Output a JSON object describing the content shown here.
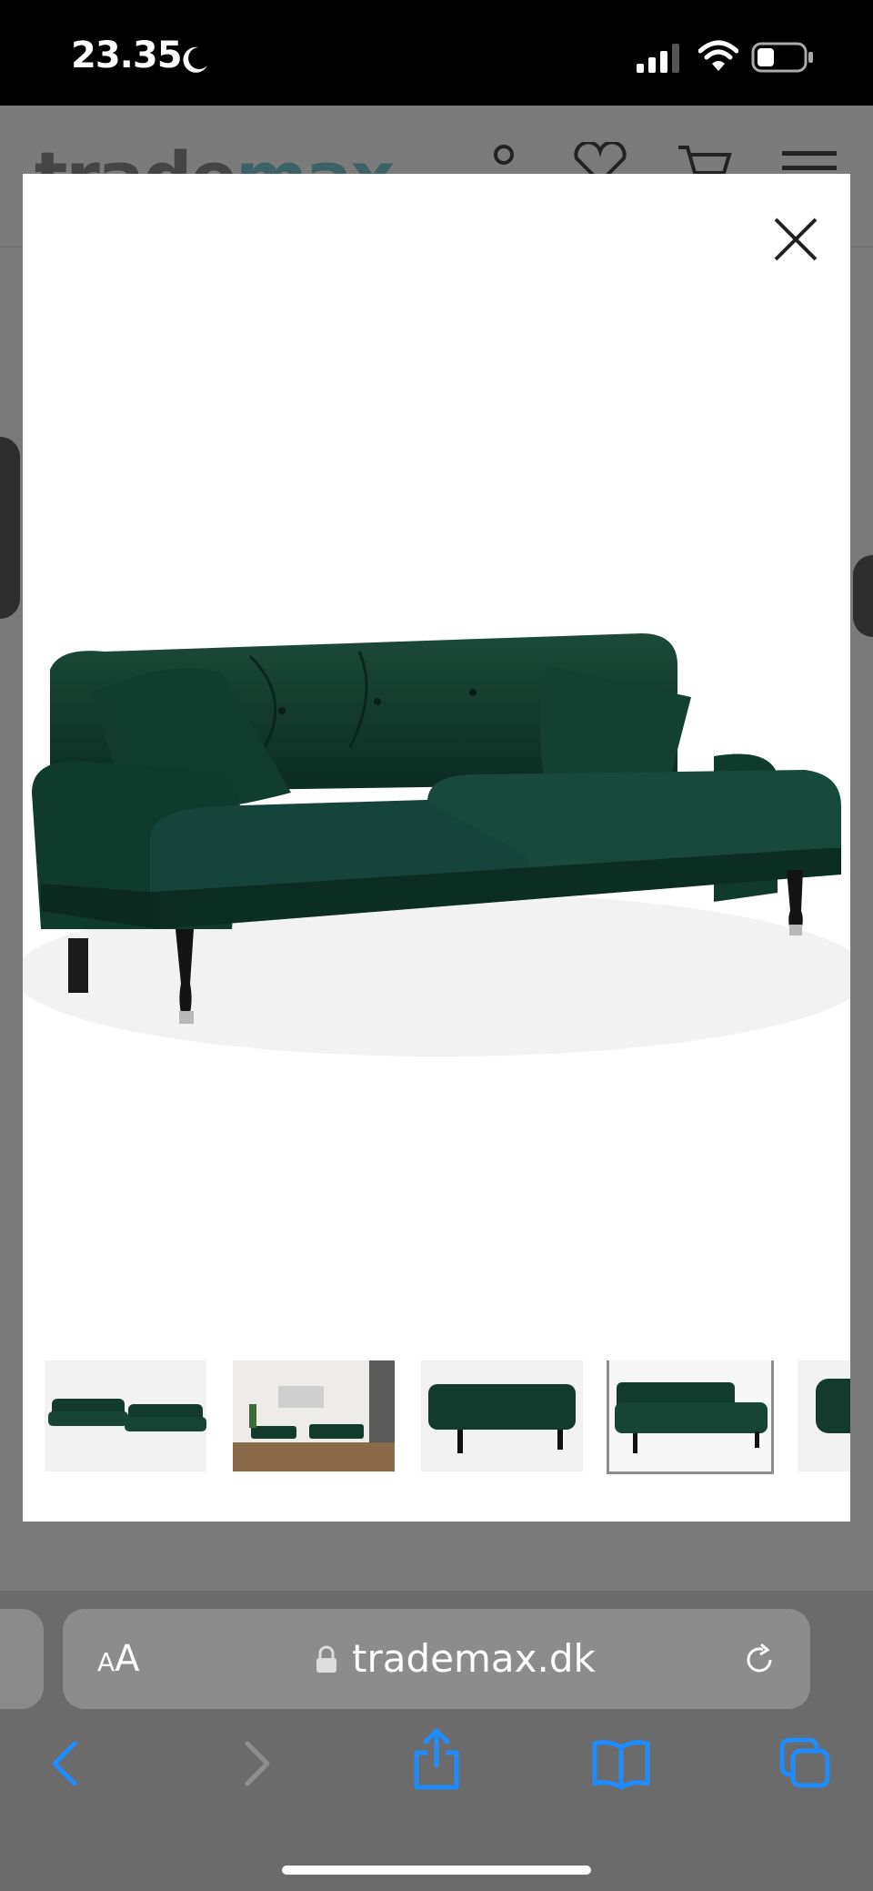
{
  "status_bar": {
    "time": "23.35",
    "icons": [
      "moon-icon",
      "signal-icon",
      "wifi-icon",
      "battery-icon"
    ]
  },
  "site_header": {
    "logo_part1": "trade",
    "logo_part2": "max",
    "icons": [
      "account-icon",
      "heart-icon",
      "cart-icon",
      "menu-icon"
    ]
  },
  "gallery": {
    "selected_index": 3,
    "thumbnails": [
      {
        "name": "thumb-sofa-set"
      },
      {
        "name": "thumb-living-room"
      },
      {
        "name": "thumb-footstool"
      },
      {
        "name": "thumb-sofa-2-seat"
      },
      {
        "name": "thumb-sofa-partial"
      }
    ],
    "colors": {
      "sofa": "#123b2d",
      "sofa_dark": "#0b2a20",
      "background": "#ffffff"
    }
  },
  "browser": {
    "reader_label_small": "A",
    "reader_label_large": "A",
    "url": "trademax.dk",
    "toolbar": [
      "back-icon",
      "forward-icon",
      "share-icon",
      "bookmarks-icon",
      "tabs-icon"
    ],
    "accent": "#1e8bff"
  }
}
